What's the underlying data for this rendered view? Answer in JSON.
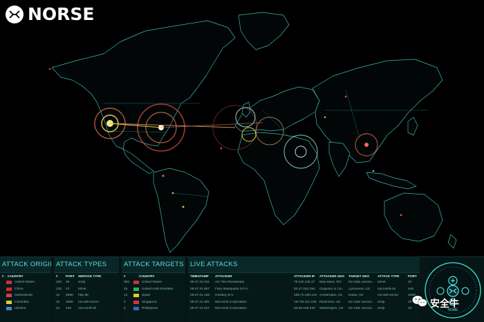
{
  "brand": {
    "logo_text": "NORSE"
  },
  "panels": {
    "origins": {
      "title": "ATTACK ORIGINS",
      "columns": [
        "#",
        "COUNTRY"
      ],
      "rows": [
        {
          "flag_color": "#c33",
          "country": "United States"
        },
        {
          "flag_color": "#d22",
          "country": "China"
        },
        {
          "flag_color": "#c44",
          "country": "Netherlands"
        },
        {
          "flag_color": "#dc3",
          "country": "Colombia"
        },
        {
          "flag_color": "#48c",
          "country": "Ukraine"
        }
      ]
    },
    "types": {
      "title": "ATTACK TYPES",
      "columns": [
        "#",
        "PORT",
        "SERVICE TYPE"
      ],
      "rows": [
        {
          "count": "225",
          "port": "25",
          "service": "smtp"
        },
        {
          "count": "133",
          "port": "23",
          "service": "telnet"
        },
        {
          "count": "12",
          "port": "8080",
          "service": "http-alt"
        },
        {
          "count": "32",
          "port": "3389",
          "service": "ms-wbt-server"
        },
        {
          "count": "22",
          "port": "445",
          "service": "microsoft-ds"
        }
      ]
    },
    "targets": {
      "title": "ATTACK TARGETS",
      "columns": [
        "#",
        "COUNTRY"
      ],
      "rows": [
        {
          "count": "394",
          "flag_color": "#c33",
          "country": "United States"
        },
        {
          "count": "16",
          "flag_color": "#3a6",
          "country": "United Arab Emirates"
        },
        {
          "count": "14",
          "flag_color": "#dc3",
          "country": "Spain"
        },
        {
          "count": "4",
          "flag_color": "#d33",
          "country": "Singapore"
        },
        {
          "count": "2",
          "flag_color": "#36c",
          "country": "Philippines"
        }
      ]
    },
    "live": {
      "title": "LIVE ATTACKS",
      "columns": [
        "TIMESTAMP",
        "ATTACKER",
        "ATTACKER IP",
        "ATTACKER GEO",
        "TARGET GEO",
        "ATTACK TYPE",
        "PORT"
      ],
      "rows": [
        {
          "time": "09:47:42.341",
          "attacker": "Arz Telv Residential",
          "ip": "79.115.140.17",
          "geo": "Baia Mare, RO",
          "target": "De Kalb Junctio...",
          "type": "telnet",
          "port": "23"
        },
        {
          "time": "09:47:41.857",
          "attacker": "Fisia Italimpianti S.P.A.",
          "ip": "83.47.153.254",
          "geo": "Gugliano in Ca...",
          "target": "Lynnwood, US",
          "type": "microsoft-ds",
          "port": "445"
        },
        {
          "time": "09:47:41.138",
          "attacker": "Hostkey B.V.",
          "ip": "185.70.186.144",
          "geo": "Amsterdam, NL",
          "target": "Dubai, AE",
          "type": "ms-wbt-server",
          "port": "3389"
        },
        {
          "time": "09:47:41.082",
          "attacker": "Microsoft Corporation",
          "ip": "157.56.111.246",
          "geo": "Redmond, US",
          "target": "De Kalb Junctio...",
          "type": "smtp",
          "port": "25"
        },
        {
          "time": "09:47:41.027",
          "attacker": "Microsoft Corporation",
          "ip": "65.55.169.249",
          "geo": "Washington, US",
          "target": "De Kalb Junctio...",
          "type": "smtp",
          "port": "25"
        }
      ]
    }
  },
  "control": {
    "home_label": "HOME"
  },
  "watermark": {
    "text": "安全牛"
  }
}
